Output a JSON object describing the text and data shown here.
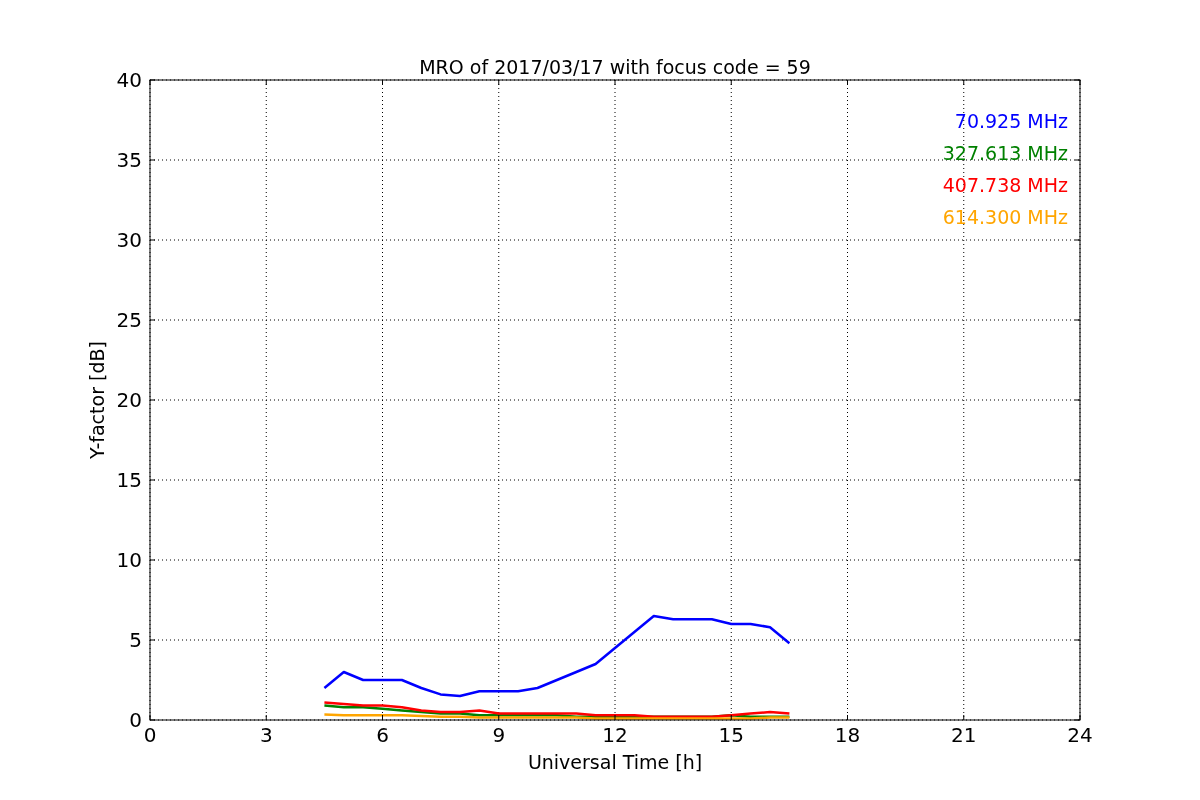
{
  "chart_data": {
    "type": "line",
    "title": "MRO of 2017/03/17 with focus code = 59",
    "xlabel": "Universal Time [h]",
    "ylabel": "Y-factor [dB]",
    "x": [
      4.5,
      5,
      5.5,
      6,
      6.5,
      7,
      7.5,
      8,
      8.5,
      9,
      9.5,
      10,
      10.5,
      11,
      11.5,
      12,
      12.5,
      13,
      13.5,
      14,
      14.5,
      15,
      15.5,
      16,
      16.5
    ],
    "series": [
      {
        "name": "70.925 MHz",
        "color": "#0000ff",
        "values": [
          2,
          3,
          2.5,
          2.5,
          2.5,
          2,
          1.6,
          1.5,
          1.8,
          1.8,
          1.8,
          2,
          2.5,
          3,
          3.5,
          4.5,
          5.5,
          6.5,
          6.3,
          6.3,
          6.3,
          6,
          6,
          5.8,
          4.8
        ]
      },
      {
        "name": "327.613 MHz",
        "color": "#008000",
        "values": [
          0.9,
          0.8,
          0.8,
          0.7,
          0.6,
          0.5,
          0.4,
          0.4,
          0.3,
          0.3,
          0.3,
          0.3,
          0.3,
          0.2,
          0.2,
          0.2,
          0.2,
          0.2,
          0.2,
          0.2,
          0.2,
          0.3,
          0.2,
          0.2,
          0.2
        ]
      },
      {
        "name": "407.738 MHz",
        "color": "#ff0000",
        "values": [
          1.1,
          1,
          0.9,
          0.9,
          0.8,
          0.6,
          0.5,
          0.5,
          0.6,
          0.4,
          0.4,
          0.4,
          0.4,
          0.4,
          0.3,
          0.3,
          0.3,
          0.2,
          0.2,
          0.2,
          0.2,
          0.3,
          0.4,
          0.5,
          0.4
        ]
      },
      {
        "name": "614.300 MHz",
        "color": "#ffa500",
        "values": [
          0.35,
          0.3,
          0.3,
          0.3,
          0.3,
          0.25,
          0.2,
          0.2,
          0.15,
          0.15,
          0.15,
          0.15,
          0.15,
          0.15,
          0.1,
          0.1,
          0.1,
          0.1,
          0.1,
          0.1,
          0.1,
          0.1,
          0.1,
          0.15,
          0.15
        ]
      }
    ],
    "grid": true,
    "xlim": [
      0,
      24
    ],
    "ylim": [
      0,
      40
    ],
    "xticks": [
      0,
      3,
      6,
      9,
      12,
      15,
      18,
      21,
      24
    ],
    "yticks": [
      0,
      5,
      10,
      15,
      20,
      25,
      30,
      35,
      40
    ]
  }
}
